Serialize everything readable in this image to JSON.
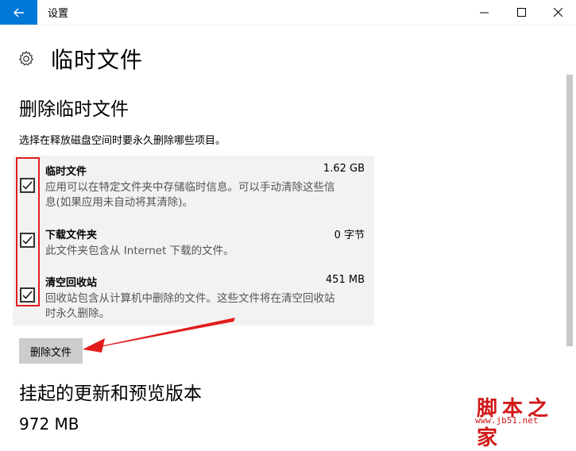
{
  "window": {
    "title": "设置",
    "back_icon": "back-arrow-icon",
    "accent": "#0078d7"
  },
  "page": {
    "title": "临时文件",
    "icon": "gear-icon"
  },
  "section1": {
    "title": "删除临时文件",
    "description": "选择在释放磁盘空间时要永久删除哪些项目。"
  },
  "items": [
    {
      "name": "临时文件",
      "size": "1.62 GB",
      "desc_line1": "应用可以在特定文件夹中存储临时信息。可以手动清除这些信",
      "desc_line2": "息(如果应用未自动将其清除)。",
      "checked": true
    },
    {
      "name": "下载文件夹",
      "size": "0 字节",
      "desc_line1": "此文件夹包含从 Internet 下载的文件。",
      "desc_line2": "",
      "checked": true
    },
    {
      "name": "清空回收站",
      "size": "451 MB",
      "desc_line1": "回收站包含从计算机中删除的文件。这些文件将在清空回收站",
      "desc_line2": "时永久删除。",
      "checked": true
    }
  ],
  "delete_button": "删除文件",
  "section2": {
    "title": "挂起的更新和预览版本",
    "size_value": "972 MB"
  },
  "annotation_color": "#e21c1c",
  "watermark": {
    "text": "脚本之家",
    "url": "www.jb51.net"
  }
}
